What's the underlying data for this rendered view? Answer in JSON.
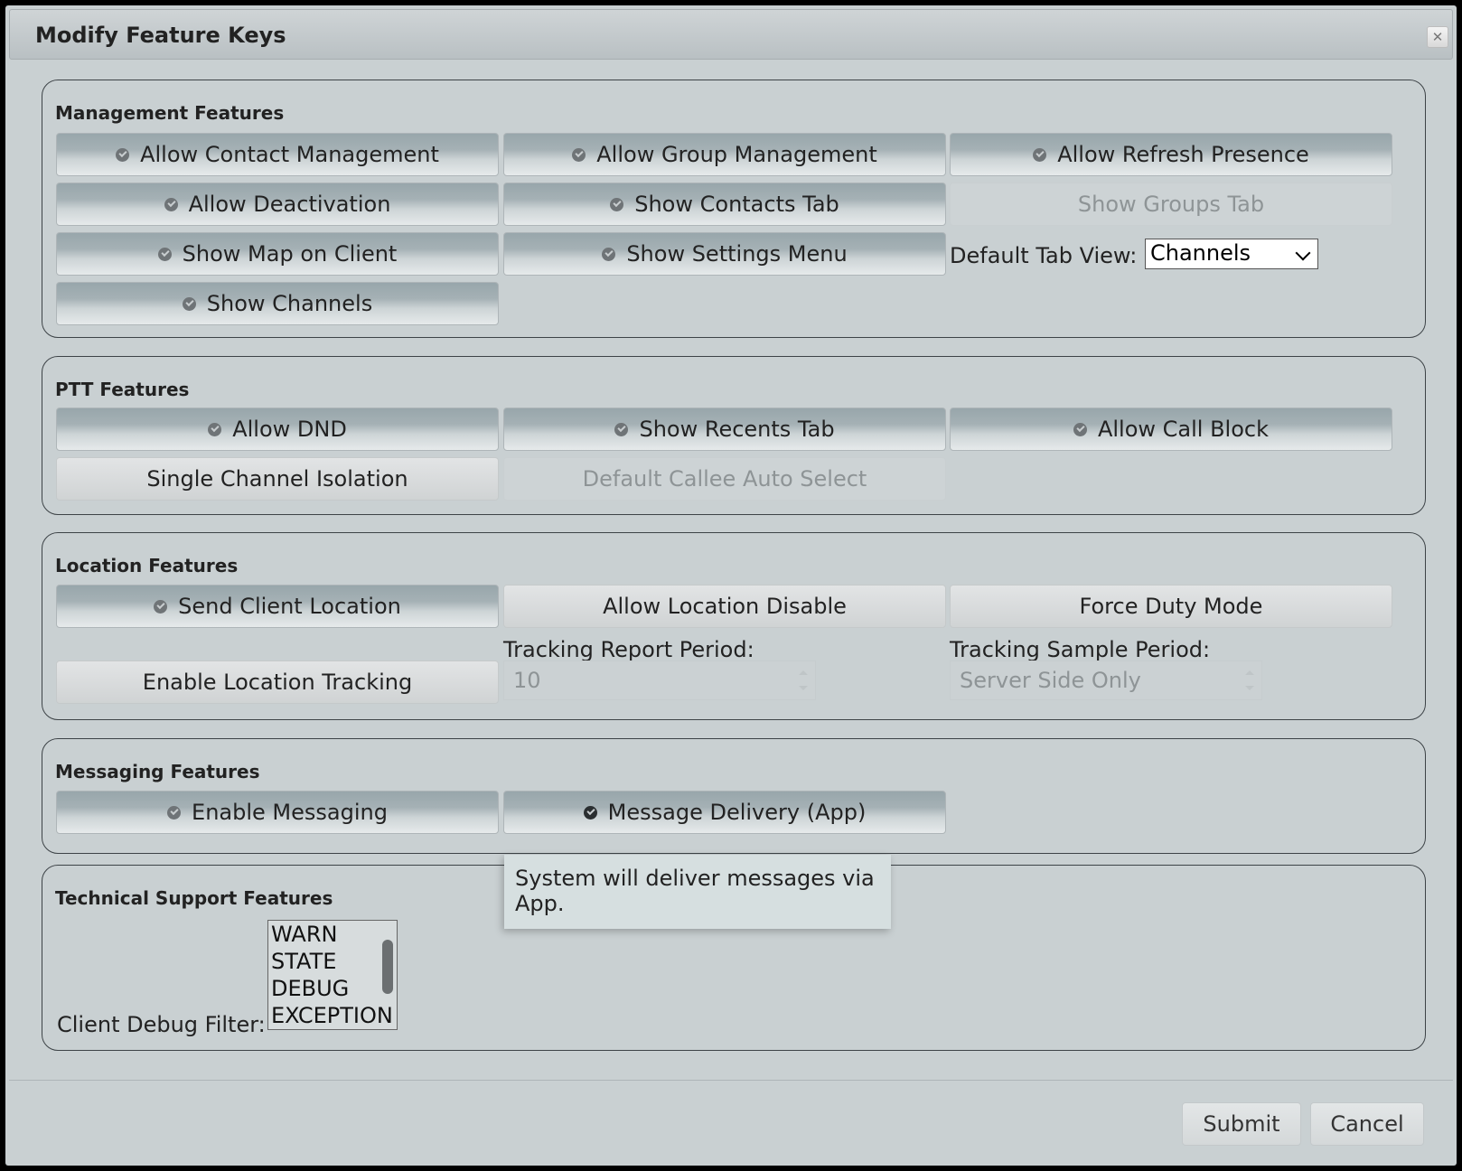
{
  "dialog": {
    "title": "Modify Feature Keys",
    "close_icon": "close-icon"
  },
  "management": {
    "legend": "Management Features",
    "allow_contact_management": "Allow Contact Management",
    "allow_group_management": "Allow Group Management",
    "allow_refresh_presence": "Allow Refresh Presence",
    "allow_deactivation": "Allow Deactivation",
    "show_contacts_tab": "Show Contacts Tab",
    "show_groups_tab": "Show Groups Tab",
    "show_map_on_client": "Show Map on Client",
    "show_settings_menu": "Show Settings Menu",
    "show_channels": "Show Channels",
    "default_tab_label": "Default Tab View:",
    "default_tab_value": "Channels"
  },
  "ptt": {
    "legend": "PTT Features",
    "allow_dnd": "Allow DND",
    "show_recents_tab": "Show Recents Tab",
    "allow_call_block": "Allow Call Block",
    "single_channel_isolation": "Single Channel Isolation",
    "default_callee_auto_select": "Default Callee Auto Select"
  },
  "location": {
    "legend": "Location Features",
    "send_client_location": "Send Client Location",
    "allow_location_disable": "Allow Location Disable",
    "force_duty_mode": "Force Duty Mode",
    "enable_location_tracking": "Enable Location Tracking",
    "tracking_report_label": "Tracking Report Period:",
    "tracking_report_value": "10",
    "tracking_sample_label": "Tracking Sample Period:",
    "tracking_sample_value": "Server Side Only"
  },
  "messaging": {
    "legend": "Messaging Features",
    "enable_messaging": "Enable Messaging",
    "message_delivery": "Message Delivery (App)",
    "tooltip": "System will deliver messages via App."
  },
  "tech": {
    "legend": "Technical Support Features",
    "debug_filter_label": "Client Debug Filter:",
    "debug_options": [
      "WARN",
      "STATE",
      "DEBUG",
      "EXCEPTION"
    ]
  },
  "footer": {
    "submit": "Submit",
    "cancel": "Cancel"
  },
  "colors": {
    "dialog_bg": "#c9d0d2",
    "border": "#3d4347",
    "selected_btn": "#98a6ab"
  }
}
